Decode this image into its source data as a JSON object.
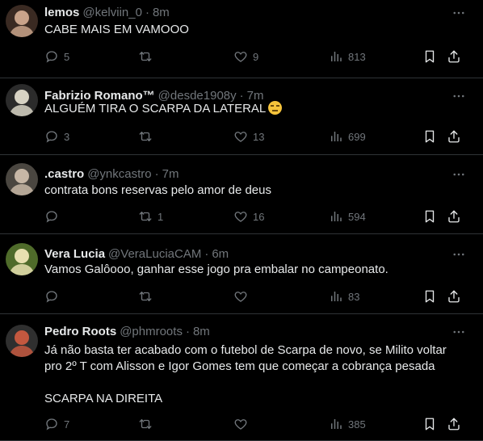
{
  "tweets": [
    {
      "name": "lemos",
      "handle": "@kelviin_0",
      "dot": "·",
      "time": "8m",
      "text": "CABE MAIS EM VAMOOO",
      "replies": "5",
      "retweets": "",
      "likes": "9",
      "views": "813",
      "avatar_colors": [
        "#c9a38a",
        "#3a2a22"
      ]
    },
    {
      "name": "Fabrizio Romano™",
      "handle": "@desde1908y",
      "dot": "·",
      "time": "7m",
      "text": "ALGUÉM TIRA O SCARPA DA LATERAL",
      "replies": "3",
      "retweets": "",
      "likes": "13",
      "views": "699",
      "avatar_colors": [
        "#d7d3c4",
        "#2b2b2b"
      ]
    },
    {
      "name": ".castro",
      "handle": "@ynkcastro",
      "dot": "·",
      "time": "7m",
      "text": "contrata bons reservas pelo amor de deus",
      "replies": "",
      "retweets": "1",
      "likes": "16",
      "views": "594",
      "avatar_colors": [
        "#c7b7a6",
        "#4a4640"
      ]
    },
    {
      "name": "Vera Lucia",
      "handle": "@VeraLuciaCAM",
      "dot": "·",
      "time": "6m",
      "text": "Vamos Galôooo, ganhar esse jogo pra embalar no campeonato.",
      "replies": "",
      "retweets": "",
      "likes": "",
      "views": "83",
      "avatar_colors": [
        "#e8e0b0",
        "#4f6b2a"
      ]
    },
    {
      "name": "Pedro Roots",
      "handle": "@phmroots",
      "dot": "·",
      "time": "8m",
      "text": "Já não basta ter acabado com o futebol de Scarpa de novo, se Milito voltar\npro 2º T com Alisson e Igor Gomes tem que começar a cobrança pesada\n\nSCARPA NA DIREITA",
      "replies": "7",
      "retweets": "",
      "likes": "",
      "views": "385",
      "avatar_colors": [
        "#c4583f",
        "#2f2f2f"
      ]
    }
  ],
  "colors": {
    "background": "#000000",
    "text": "#e7e9ea",
    "muted": "#71767b",
    "divider": "#2f3336"
  },
  "icons": [
    "reply-icon",
    "retweet-icon",
    "like-icon",
    "views-icon",
    "bookmark-icon",
    "share-icon",
    "more-icon"
  ]
}
